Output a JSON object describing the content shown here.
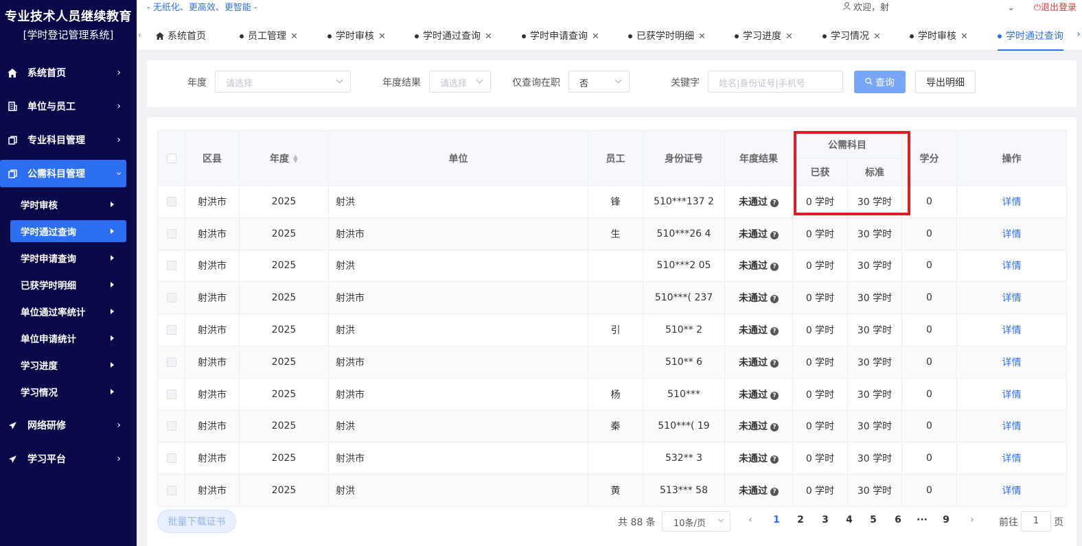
{
  "brand": {
    "title": "专业技术人员继续教育",
    "subtitle": "[学时登记管理系统]"
  },
  "sidebar": {
    "menus": [
      {
        "label": "系统首页",
        "icon": "home-icon"
      },
      {
        "label": "单位与员工",
        "icon": "building-icon"
      },
      {
        "label": "专业科目管理",
        "icon": "copy-icon"
      },
      {
        "label": "公需科目管理",
        "icon": "copy-icon"
      },
      {
        "label": "网络研修",
        "icon": "send-icon"
      },
      {
        "label": "学习平台",
        "icon": "send-icon"
      }
    ],
    "submenu": [
      "学时审核",
      "学时通过查询",
      "学时申请查询",
      "已获学时明细",
      "单位通过率统计",
      "单位申请统计",
      "学习进度",
      "学习情况"
    ]
  },
  "topbar": {
    "slogan": "- 无纸化、更高效、更智能 -",
    "welcome": "欢迎，射",
    "logout": "退出登录"
  },
  "tabs": [
    {
      "label": "系统首页"
    },
    {
      "label": "员工管理"
    },
    {
      "label": "学时审核"
    },
    {
      "label": "学时通过查询"
    },
    {
      "label": "学时申请查询"
    },
    {
      "label": "已获学时明细"
    },
    {
      "label": "学习进度"
    },
    {
      "label": "学习情况"
    },
    {
      "label": "学时审核"
    },
    {
      "label": "学时通过查询"
    }
  ],
  "filter": {
    "year_label": "年度",
    "year_placeholder": "请选择",
    "result_label": "年度结果",
    "result_placeholder": "请选择",
    "employed_label": "仅查询在职",
    "employed_value": "否",
    "keyword_label": "关键字",
    "keyword_placeholder": "姓名|身份证号|手机号",
    "query_button": "查询",
    "export_button": "导出明细"
  },
  "table": {
    "headers": {
      "district": "区县",
      "year": "年度",
      "unit": "单位",
      "employee": "员工",
      "id_number": "身份证号",
      "annual_result": "年度结果",
      "public_subject": "公需科目",
      "obtained": "已获",
      "standard": "标准",
      "credit": "学分",
      "action": "操作"
    },
    "rows": [
      {
        "district": "射洪市",
        "year": "2025",
        "unit": "射洪",
        "employee": "锋",
        "id": "510***137  2",
        "result": "未通过",
        "obtained": "0 学时",
        "standard": "30 学时",
        "credit": "0",
        "action": "详情"
      },
      {
        "district": "射洪市",
        "year": "2025",
        "unit": "射洪市",
        "employee": "生",
        "id": "510***26  4",
        "result": "未通过",
        "obtained": "0 学时",
        "standard": "30 学时",
        "credit": "0",
        "action": "详情"
      },
      {
        "district": "射洪市",
        "year": "2025",
        "unit": "射洪",
        "employee": "",
        "id": "510***2  05",
        "result": "未通过",
        "obtained": "0 学时",
        "standard": "30 学时",
        "credit": "0",
        "action": "详情"
      },
      {
        "district": "射洪市",
        "year": "2025",
        "unit": "射洪市",
        "employee": "",
        "id": "510***(  237",
        "result": "未通过",
        "obtained": "0 学时",
        "standard": "30 学时",
        "credit": "0",
        "action": "详情"
      },
      {
        "district": "射洪市",
        "year": "2025",
        "unit": "射洪",
        "employee": "引",
        "id": "510**  2",
        "result": "未通过",
        "obtained": "0 学时",
        "standard": "30 学时",
        "credit": "0",
        "action": "详情"
      },
      {
        "district": "射洪市",
        "year": "2025",
        "unit": "射洪市",
        "employee": "",
        "id": "510**  6",
        "result": "未通过",
        "obtained": "0 学时",
        "standard": "30 学时",
        "credit": "0",
        "action": "详情"
      },
      {
        "district": "射洪市",
        "year": "2025",
        "unit": "射洪市",
        "employee": "杨",
        "id": "510***",
        "result": "未通过",
        "obtained": "0 学时",
        "standard": "30 学时",
        "credit": "0",
        "action": "详情"
      },
      {
        "district": "射洪市",
        "year": "2025",
        "unit": "射洪",
        "employee": "秦",
        "id": "510***(  19",
        "result": "未通过",
        "obtained": "0 学时",
        "standard": "30 学时",
        "credit": "0",
        "action": "详情"
      },
      {
        "district": "射洪市",
        "year": "2025",
        "unit": "射洪市",
        "employee": "",
        "id": "532**  3",
        "result": "未通过",
        "obtained": "0 学时",
        "standard": "30 学时",
        "credit": "0",
        "action": "详情"
      },
      {
        "district": "射洪市",
        "year": "2025",
        "unit": "射洪",
        "employee": "黄",
        "id": "513***  58",
        "result": "未通过",
        "obtained": "0 学时",
        "standard": "30 学时",
        "credit": "0",
        "action": "详情"
      }
    ]
  },
  "footer": {
    "batch_button": "批量下载证书",
    "total": "共 88 条",
    "page_size": "10条/页",
    "pages": [
      "1",
      "2",
      "3",
      "4",
      "5",
      "6",
      "···",
      "9"
    ],
    "current_page": "1",
    "goto_label": "前往",
    "goto_value": "1",
    "goto_suffix": "页"
  },
  "colors": {
    "sidebar": "#0a0a4a",
    "accent": "#2d6ff2",
    "highlight": "#e11b22",
    "logout": "#e23b3b"
  }
}
